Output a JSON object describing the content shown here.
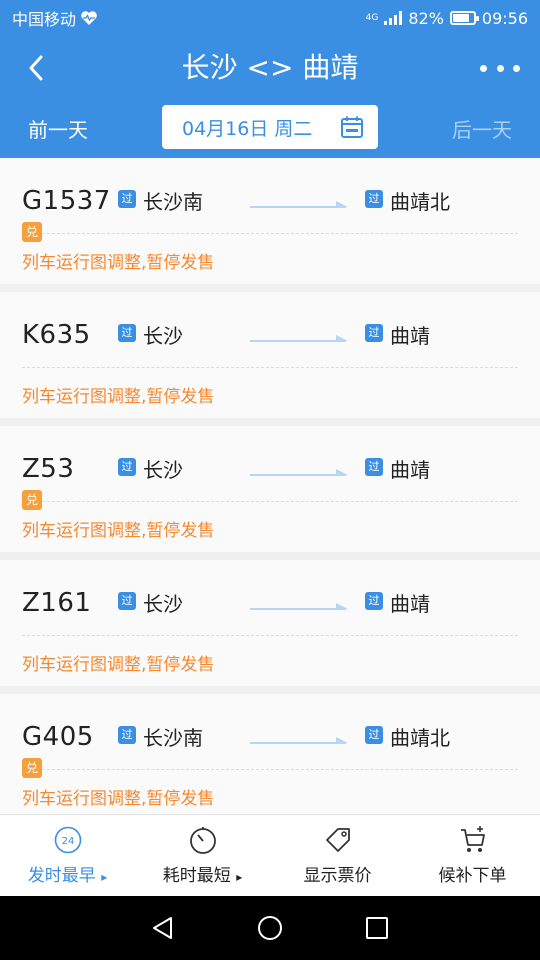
{
  "status": {
    "carrier": "中国移动",
    "network": "4G",
    "battery": "82%",
    "battery_level": 0.82,
    "time": "09:56"
  },
  "header": {
    "title": "长沙 <> 曲靖"
  },
  "datebar": {
    "prev": "前一天",
    "date": "04月16日 周二",
    "next": "后一天"
  },
  "tag_pass": "过",
  "tag_dui": "兑",
  "trains": [
    {
      "no": "G1537",
      "from": "长沙南",
      "to": "曲靖北",
      "dui": true,
      "msg": "列车运行图调整,暂停发售"
    },
    {
      "no": "K635",
      "from": "长沙",
      "to": "曲靖",
      "dui": false,
      "msg": "列车运行图调整,暂停发售"
    },
    {
      "no": "Z53",
      "from": "长沙",
      "to": "曲靖",
      "dui": true,
      "msg": "列车运行图调整,暂停发售"
    },
    {
      "no": "Z161",
      "from": "长沙",
      "to": "曲靖",
      "dui": false,
      "msg": "列车运行图调整,暂停发售"
    },
    {
      "no": "G405",
      "from": "长沙南",
      "to": "曲靖北",
      "dui": true,
      "msg": "列车运行图调整,暂停发售"
    }
  ],
  "toolbar": {
    "earliest": "发时最早",
    "earliest_badge": "24",
    "shortest": "耗时最短",
    "price": "显示票价",
    "waitlist": "候补下单"
  },
  "colors": {
    "primary": "#3a8fe3",
    "warning": "#f5892f",
    "dui": "#f5a03b"
  }
}
